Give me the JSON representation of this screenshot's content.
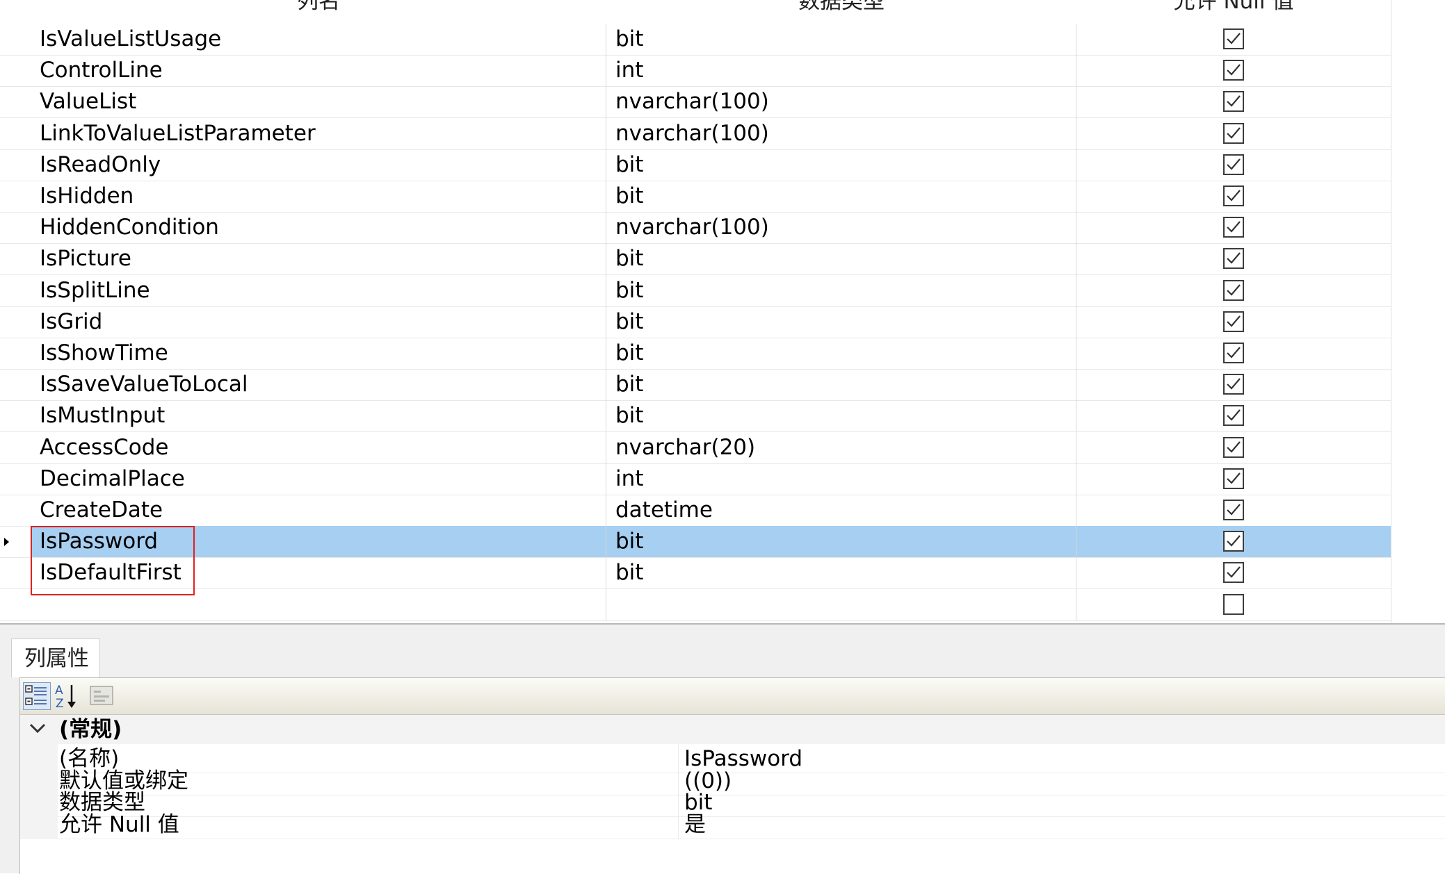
{
  "grid": {
    "headers": {
      "name": "列名",
      "type": "数据类型",
      "nullable": "允许 Null 值"
    },
    "rows": [
      {
        "name": "IsValueListUsage",
        "type": "bit",
        "allow_null": true
      },
      {
        "name": "ControlLine",
        "type": "int",
        "allow_null": true
      },
      {
        "name": "ValueList",
        "type": "nvarchar(100)",
        "allow_null": true
      },
      {
        "name": "LinkToValueListParameter",
        "type": "nvarchar(100)",
        "allow_null": true
      },
      {
        "name": "IsReadOnly",
        "type": "bit",
        "allow_null": true
      },
      {
        "name": "IsHidden",
        "type": "bit",
        "allow_null": true
      },
      {
        "name": "HiddenCondition",
        "type": "nvarchar(100)",
        "allow_null": true
      },
      {
        "name": "IsPicture",
        "type": "bit",
        "allow_null": true
      },
      {
        "name": "IsSplitLine",
        "type": "bit",
        "allow_null": true
      },
      {
        "name": "IsGrid",
        "type": "bit",
        "allow_null": true
      },
      {
        "name": "IsShowTime",
        "type": "bit",
        "allow_null": true
      },
      {
        "name": "IsSaveValueToLocal",
        "type": "bit",
        "allow_null": true
      },
      {
        "name": "IsMustInput",
        "type": "bit",
        "allow_null": true
      },
      {
        "name": "AccessCode",
        "type": "nvarchar(20)",
        "allow_null": true
      },
      {
        "name": "DecimalPlace",
        "type": "int",
        "allow_null": true
      },
      {
        "name": "CreateDate",
        "type": "datetime",
        "allow_null": true
      },
      {
        "name": "IsPassword",
        "type": "bit",
        "allow_null": true,
        "selected": true
      },
      {
        "name": "IsDefaultFirst",
        "type": "bit",
        "allow_null": true
      },
      {
        "name": "",
        "type": "",
        "allow_null": false
      }
    ],
    "selection_color": "#a7cff1",
    "highlight_box_color": "#e02020"
  },
  "properties": {
    "tab_label": "列属性",
    "toolbar": {
      "categorized_icon": "categorized-icon",
      "alphabetical_icon": "sort-az-icon",
      "property_pages_icon": "property-pages-icon"
    },
    "category": "(常规)",
    "rows": [
      {
        "name": "(名称)",
        "value": "IsPassword"
      },
      {
        "name": "默认值或绑定",
        "value": "((0))"
      },
      {
        "name": "数据类型",
        "value": "bit"
      },
      {
        "name": "允许 Null 值",
        "value": "是"
      }
    ]
  }
}
